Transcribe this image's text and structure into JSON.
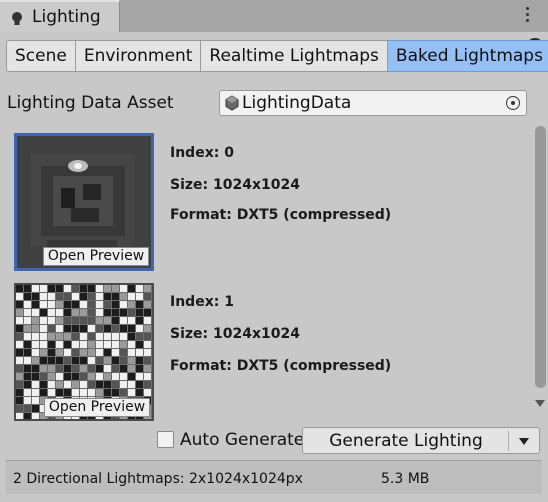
{
  "window": {
    "title": "Lighting",
    "icon": "lightbulb-icon",
    "menu_icon": "kebab-menu-icon",
    "help_icon": "help-icon",
    "help_glyph": "?"
  },
  "tabs": [
    {
      "label": "Scene",
      "active": false
    },
    {
      "label": "Environment",
      "active": false
    },
    {
      "label": "Realtime Lightmaps",
      "active": false
    },
    {
      "label": "Baked Lightmaps",
      "active": true
    }
  ],
  "lighting_data_asset": {
    "label": "Lighting Data Asset",
    "value": "LightingData",
    "icon": "asset-cube-icon",
    "picker_icon": "object-picker-icon"
  },
  "lightmaps": [
    {
      "index_text": "Index: 0",
      "size_text": "Size: 1024x1024",
      "format_text": "Format: DXT5 (compressed)",
      "button": "Open Preview",
      "selected": true
    },
    {
      "index_text": "Index: 1",
      "size_text": "Size: 1024x1024",
      "format_text": "Format: DXT5 (compressed)",
      "button": "Open Preview",
      "selected": false
    }
  ],
  "auto_generate": {
    "label": "Auto Generate",
    "checked": false
  },
  "generate_button": {
    "label": "Generate Lighting"
  },
  "status": {
    "summary": "2 Directional Lightmaps: 2x1024x1024px",
    "size": "5.3 MB"
  },
  "colors": {
    "accent": "#96c0f5",
    "selection": "#3e64b4",
    "panel": "#c8c8c8"
  }
}
